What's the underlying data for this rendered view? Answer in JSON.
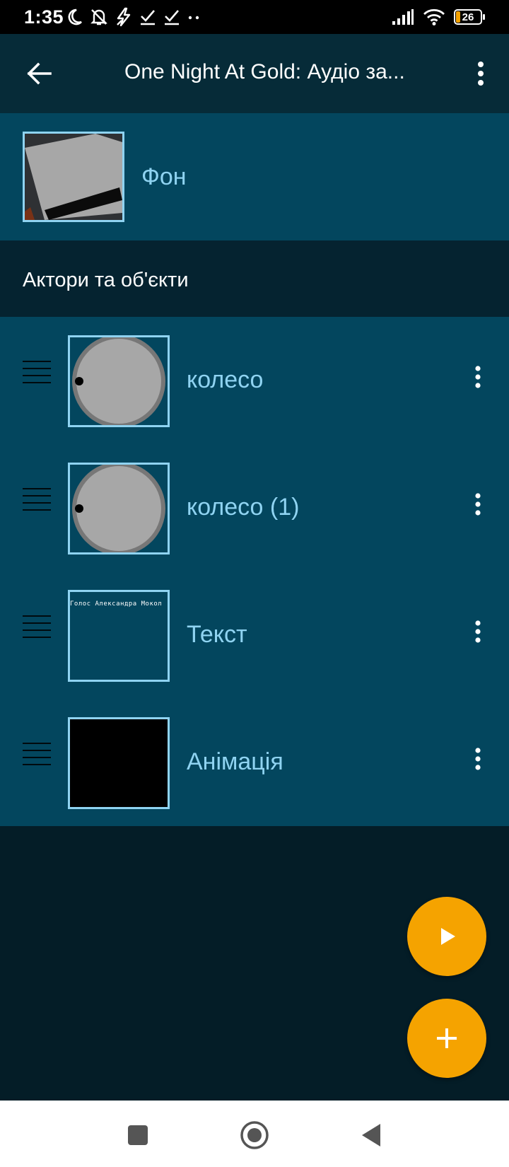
{
  "status_bar": {
    "time": "1:35",
    "battery_level": "26",
    "icons_left": [
      "moon-icon",
      "bell-off-icon",
      "flash-icon",
      "check-download-icon",
      "check-download-icon",
      "more-dots-icon"
    ],
    "icons_right": [
      "signal-icon",
      "wifi-icon",
      "battery-icon"
    ]
  },
  "app_bar": {
    "title": "One Night At Gold: Аудіо за...",
    "back_icon": "arrow-back-icon",
    "menu_icon": "more-vert-icon"
  },
  "background": {
    "label": "Фон"
  },
  "section": {
    "title": "Актори та об'єкти"
  },
  "actors": [
    {
      "label": "колесо"
    },
    {
      "label": "колесо (1)"
    },
    {
      "label": "Текст",
      "thumbnail_text": "Голос Александра Мокол"
    },
    {
      "label": "Анімація"
    }
  ],
  "colors": {
    "accent": "#f5a300",
    "label_blue": "#8fd3f1",
    "row_bg": "#03465e",
    "app_bar_bg": "#062b38",
    "screen_bg": "#041d27"
  },
  "fabs": [
    "play-icon",
    "plus-icon"
  ],
  "nav_bar": [
    "recents-square-icon",
    "home-circle-icon",
    "back-triangle-icon"
  ]
}
